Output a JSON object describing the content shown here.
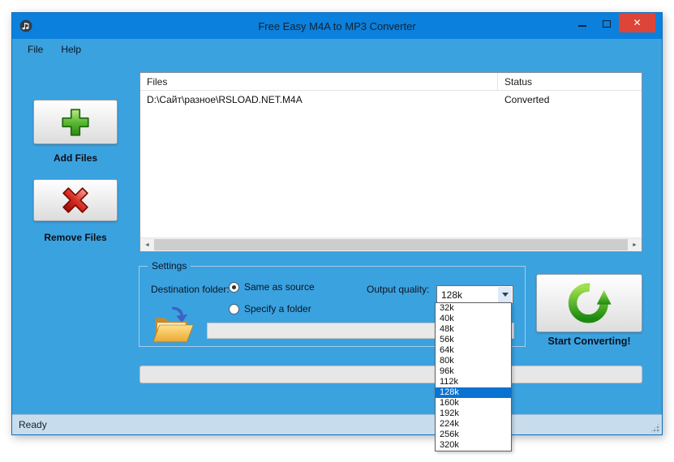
{
  "window": {
    "title": "Free Easy M4A to MP3 Converter",
    "menu": {
      "file": "File",
      "help": "Help"
    },
    "status": "Ready"
  },
  "icons": {
    "close": "✕",
    "scroll_left": "◄",
    "scroll_right": "►"
  },
  "toolbar": {
    "add_files_label": "Add Files",
    "remove_files_label": "Remove Files"
  },
  "file_list": {
    "columns": [
      "Files",
      "Status"
    ],
    "rows": [
      {
        "file": "D:\\Сайт\\разное\\RSLOAD.NET.M4A",
        "status": "Converted"
      }
    ]
  },
  "settings": {
    "group_label": "Settings",
    "destination_label": "Destination folder:",
    "same_as_source": "Same as source",
    "specify_folder": "Specify a folder",
    "folder_path_value": "",
    "output_quality_label": "Output quality:",
    "output_quality_value": "128k",
    "quality_options": [
      "32k",
      "40k",
      "48k",
      "56k",
      "64k",
      "80k",
      "96k",
      "112k",
      "128k",
      "160k",
      "192k",
      "224k",
      "256k",
      "320k"
    ]
  },
  "actions": {
    "start_label": "Start Converting!"
  },
  "colors": {
    "titlebar": "#0c80dd",
    "body": "#3ba2e0",
    "close_button": "#dd4538",
    "selection": "#0a72d0"
  }
}
